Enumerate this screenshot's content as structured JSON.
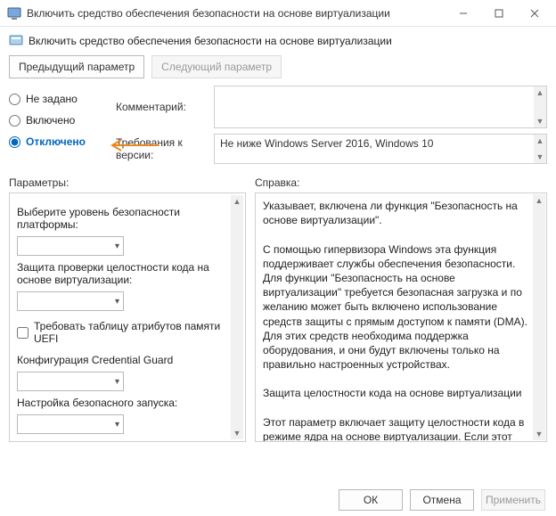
{
  "window": {
    "title": "Включить средство обеспечения безопасности на основе виртуализации"
  },
  "heading": "Включить средство обеспечения безопасности на основе виртуализации",
  "nav": {
    "prev": "Предыдущий параметр",
    "next": "Следующий параметр"
  },
  "radios": {
    "not_configured": "Не задано",
    "enabled": "Включено",
    "disabled": "Отключено",
    "selected": "disabled"
  },
  "fields": {
    "comment_label": "Комментарий:",
    "requirements_label": "Требования к версии:",
    "requirements_value": "Не ниже Windows Server 2016, Windows 10"
  },
  "columns": {
    "params_header": "Параметры:",
    "help_header": "Справка:"
  },
  "params": {
    "platform_security_label": "Выберите уровень безопасности платформы:",
    "code_integrity_label": "Защита проверки целостности кода на основе виртуализации:",
    "uefi_checkbox": "Требовать таблицу атрибутов памяти UEFI",
    "credential_guard_label": "Конфигурация Credential Guard",
    "secure_launch_label": "Настройка безопасного запуска:"
  },
  "help": {
    "text": "Указывает, включена ли функция \"Безопасность на основе виртуализации\".\n\nС помощью гипервизора Windows эта функция поддерживает службы обеспечения безопасности. Для функции \"Безопасность на основе виртуализации\" требуется безопасная загрузка и по желанию может быть включено использование средств защиты с прямым доступом к памяти (DMA). Для этих средств необходима поддержка оборудования, и они будут включены только на правильно настроенных устройствах.\n\nЗащита целостности кода на основе виртуализации\n\nЭтот параметр включает защиту целостности кода в режиме ядра на основе виртуализации. Если этот параметр включен, принудительно применяются средства защиты памяти в режиме ядра и путь для проверки целостности кода защищен с помощью функции \"Безопасность на основе"
  },
  "buttons": {
    "ok": "ОК",
    "cancel": "Отмена",
    "apply": "Применить"
  }
}
